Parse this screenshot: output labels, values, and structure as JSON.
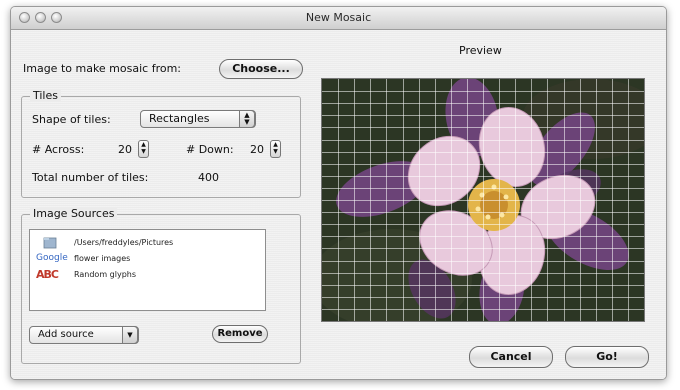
{
  "window": {
    "title": "New Mosaic"
  },
  "image_row": {
    "label": "Image to make mosaic from:",
    "choose_button": "Choose..."
  },
  "tiles": {
    "legend": "Tiles",
    "shape_label": "Shape of tiles:",
    "shape_value": "Rectangles",
    "across_label": "# Across:",
    "across_value": "20",
    "down_label": "# Down:",
    "down_value": "20",
    "total_label": "Total number of tiles:",
    "total_value": "400"
  },
  "sources": {
    "legend": "Image Sources",
    "items": [
      {
        "icon": "folder-icon",
        "label": "/Users/freddyles/Pictures"
      },
      {
        "icon": "google-logo",
        "icon_text": "Google",
        "label": "flower images"
      },
      {
        "icon": "abc-glyphs-icon",
        "icon_text": "ABC",
        "label": "Random glyphs"
      }
    ],
    "add_source": "Add source",
    "remove_button": "Remove"
  },
  "preview": {
    "label": "Preview",
    "grid_columns": 20,
    "grid_rows": 20
  },
  "buttons": {
    "cancel": "Cancel",
    "go": "Go!"
  },
  "colors": {
    "window_bg": "#ececec",
    "preview_bg": "#2c3624",
    "petal": "#e8c9dc",
    "sepal": "#6b4377",
    "center": "#e3b54a"
  }
}
